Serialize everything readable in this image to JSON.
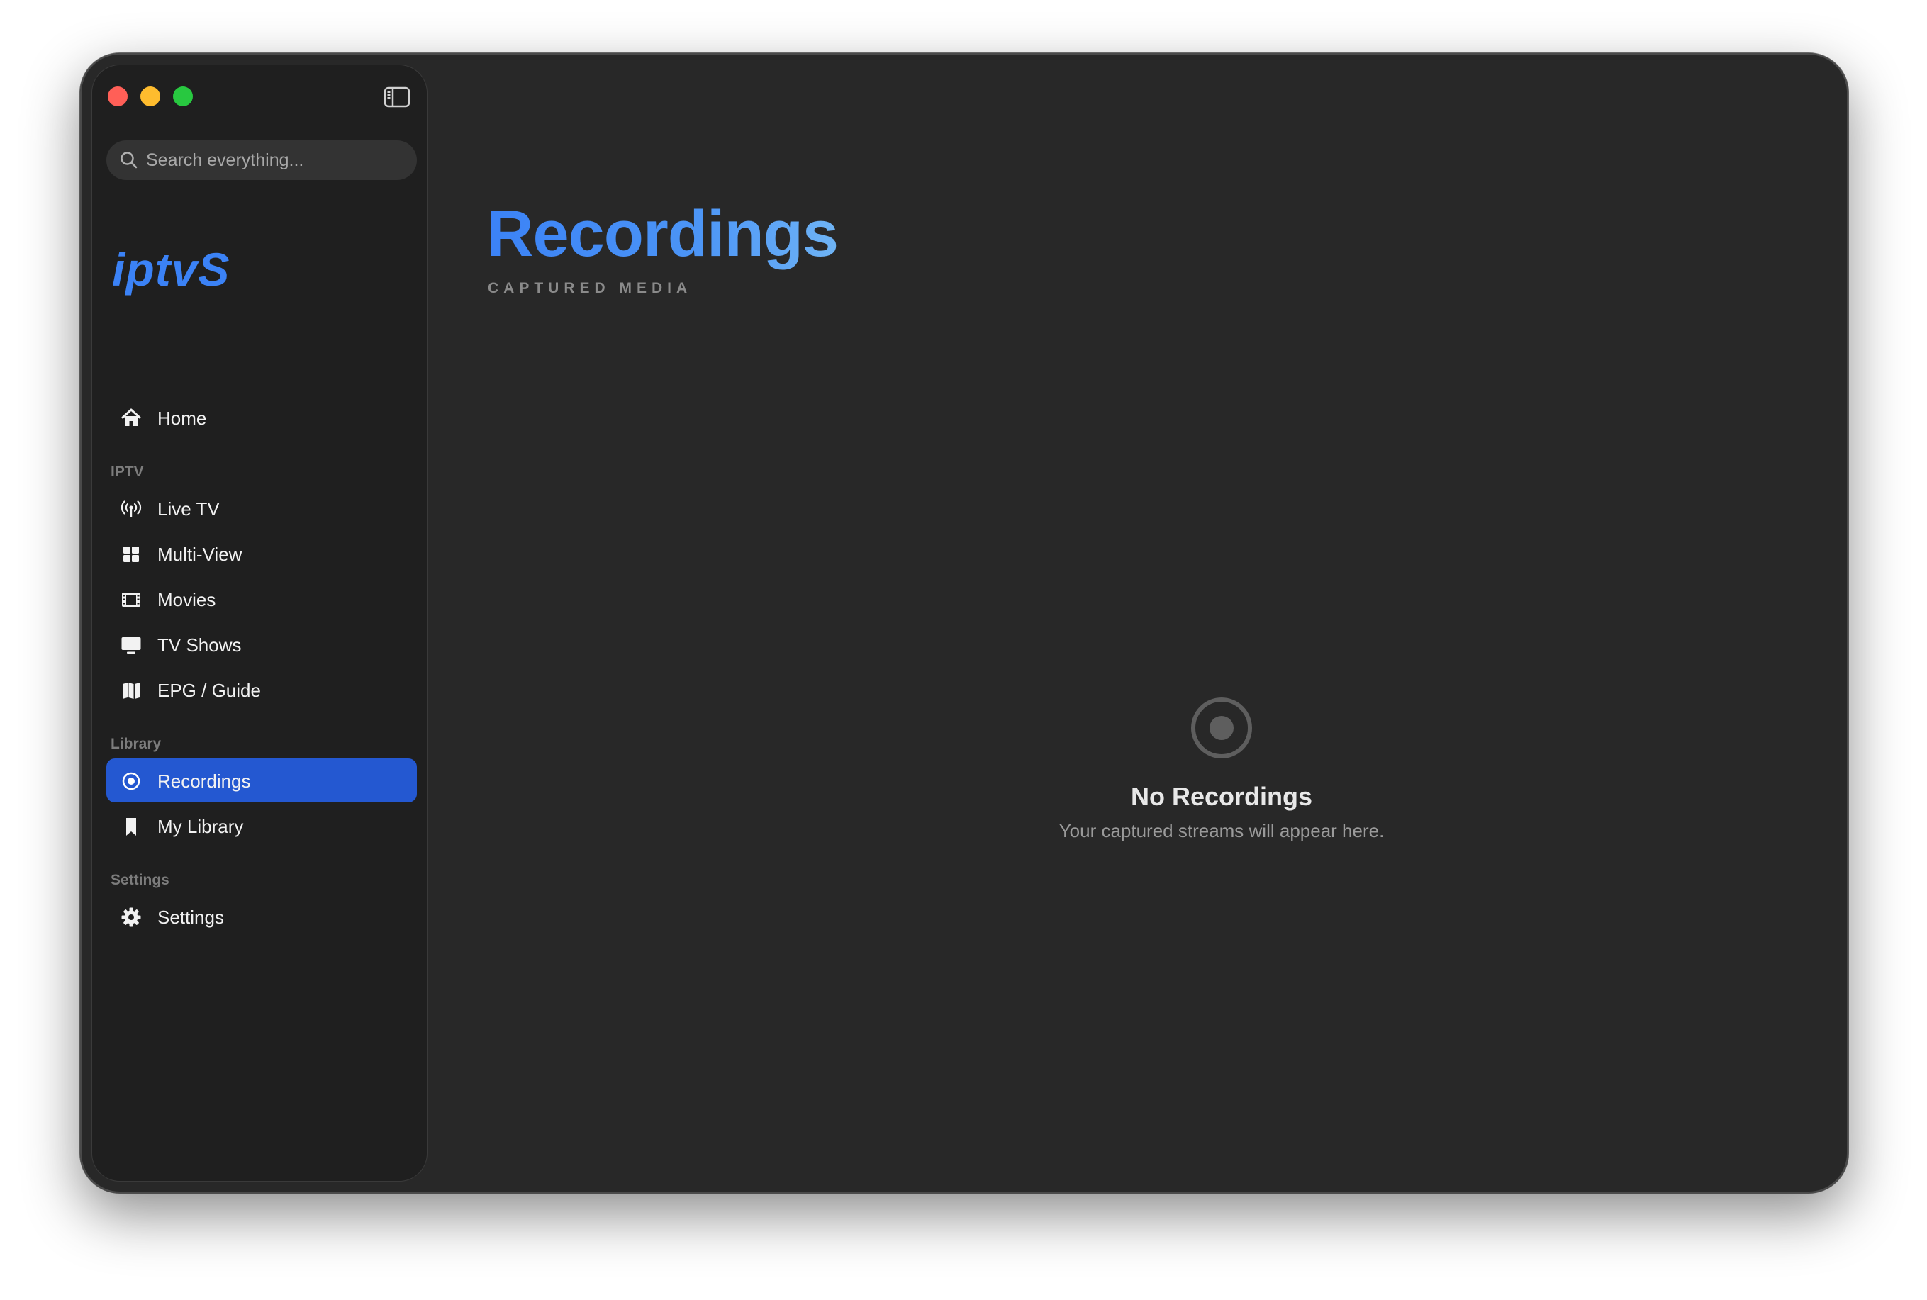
{
  "window": {
    "traffic_lights": [
      "close",
      "minimize",
      "zoom"
    ]
  },
  "sidebar": {
    "search": {
      "placeholder": "Search everything..."
    },
    "logo": "iptvS",
    "items": [
      {
        "label": "Home",
        "icon": "house-icon"
      },
      {
        "section": "IPTV"
      },
      {
        "label": "Live TV",
        "icon": "antenna-icon"
      },
      {
        "label": "Multi-View",
        "icon": "grid-icon"
      },
      {
        "label": "Movies",
        "icon": "film-icon"
      },
      {
        "label": "TV Shows",
        "icon": "tv-icon"
      },
      {
        "label": "EPG / Guide",
        "icon": "map-icon"
      },
      {
        "section": "Library"
      },
      {
        "label": "Recordings",
        "icon": "record-icon",
        "active": true
      },
      {
        "label": "My Library",
        "icon": "bookmark-icon"
      },
      {
        "section": "Settings"
      },
      {
        "label": "Settings",
        "icon": "gear-icon"
      }
    ],
    "sections": {
      "iptv": "IPTV",
      "library": "Library",
      "settings": "Settings"
    },
    "labels": {
      "home": "Home",
      "live_tv": "Live TV",
      "multi_view": "Multi-View",
      "movies": "Movies",
      "tv_shows": "TV Shows",
      "epg": "EPG / Guide",
      "recordings": "Recordings",
      "my_library": "My Library",
      "settings": "Settings"
    }
  },
  "main": {
    "title": "Recordings",
    "subtitle": "CAPTURED MEDIA",
    "empty_state": {
      "icon": "record-icon",
      "title": "No Recordings",
      "message": "Your captured streams will appear here."
    }
  },
  "colors": {
    "accent": "#3b82f6",
    "active_item": "#2458d1",
    "background": "#282828",
    "sidebar": "#1f1f1f"
  }
}
